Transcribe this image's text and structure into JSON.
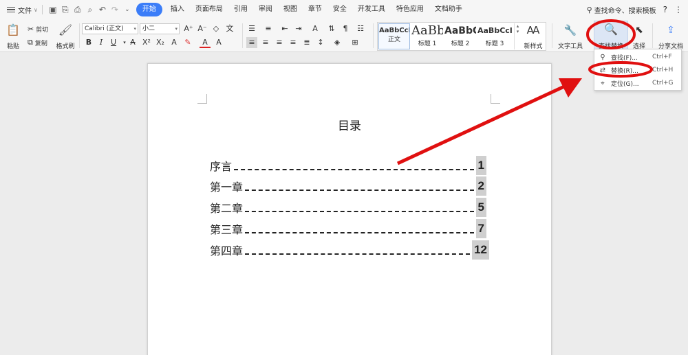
{
  "menubar": {
    "file": "文件",
    "tabs": [
      "开始",
      "插入",
      "页面布局",
      "引用",
      "审阅",
      "视图",
      "章节",
      "安全",
      "开发工具",
      "特色应用",
      "文档助手"
    ],
    "active_tab": "开始",
    "search_commands": "查找命令、搜索模板",
    "help": "?"
  },
  "ribbon": {
    "paste": "粘贴",
    "cut": "剪切",
    "copy": "复制",
    "format_painter": "格式刷",
    "font_name": "Calibri (正文)",
    "font_size": "小二",
    "styles": [
      {
        "sample": "AaBbCcDd",
        "name": "正文"
      },
      {
        "sample": "AaBb",
        "name": "标题 1"
      },
      {
        "sample": "AaBbC",
        "name": "标题 2"
      },
      {
        "sample": "AaBbCcI",
        "name": "标题 3"
      }
    ],
    "new_style": "新样式",
    "text_tools": "文字工具",
    "find_replace": "查找替换",
    "select": "选择",
    "share": "分享文档"
  },
  "dropdown": {
    "items": [
      {
        "label": "查找(F)...",
        "shortcut": "Ctrl+F"
      },
      {
        "label": "替换(R)...",
        "shortcut": "Ctrl+H"
      },
      {
        "label": "定位(G)...",
        "shortcut": "Ctrl+G"
      }
    ]
  },
  "document": {
    "title": "目录",
    "toc": [
      {
        "label": "序言",
        "page": "1"
      },
      {
        "label": "第一章",
        "page": "2"
      },
      {
        "label": "第二章",
        "page": "5"
      },
      {
        "label": "第三章",
        "page": "7"
      },
      {
        "label": "第四章",
        "page": "12"
      }
    ]
  },
  "colors": {
    "accent": "#3b7df8",
    "annotation": "#e01010",
    "highlight": "#cfcfcf"
  }
}
